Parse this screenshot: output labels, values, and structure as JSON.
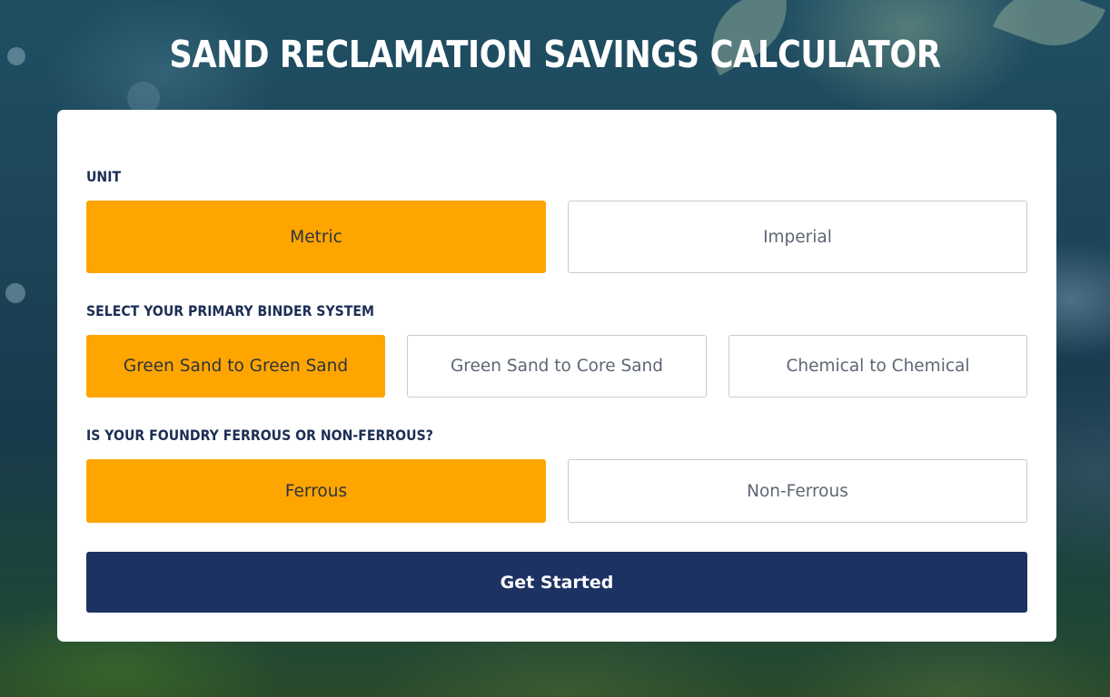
{
  "title": "SAND RECLAMATION SAVINGS CALCULATOR",
  "unit": {
    "label": "UNIT",
    "options": [
      {
        "label": "Metric",
        "selected": true
      },
      {
        "label": "Imperial",
        "selected": false
      }
    ]
  },
  "binder": {
    "label": "SELECT YOUR PRIMARY BINDER SYSTEM",
    "options": [
      {
        "label": "Green Sand to Green Sand",
        "selected": true
      },
      {
        "label": "Green Sand to Core Sand",
        "selected": false
      },
      {
        "label": "Chemical to Chemical",
        "selected": false
      }
    ]
  },
  "foundry": {
    "label": "IS YOUR FOUNDRY FERROUS OR NON-FERROUS?",
    "options": [
      {
        "label": "Ferrous",
        "selected": true
      },
      {
        "label": "Non-Ferrous",
        "selected": false
      }
    ]
  },
  "start_button": "Get Started",
  "colors": {
    "selected": "#ffa500",
    "primary_button": "#1c3263",
    "label_text": "#1c2f55"
  }
}
